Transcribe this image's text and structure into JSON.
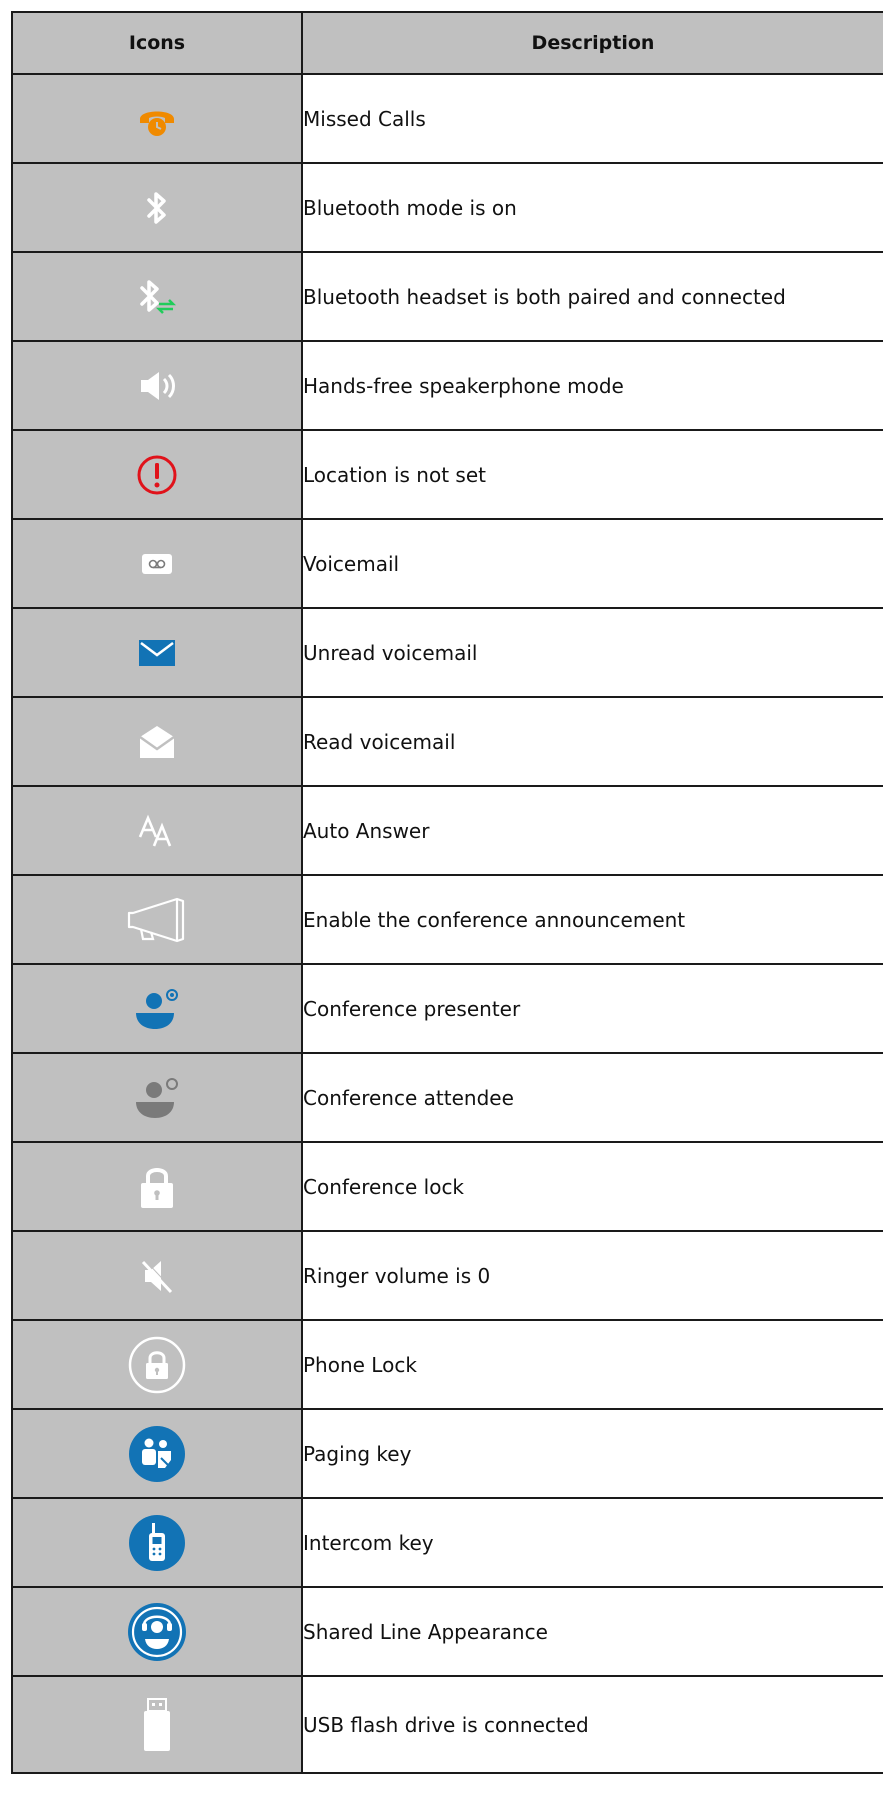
{
  "table": {
    "headers": {
      "icons": "Icons",
      "description": "Description"
    },
    "rows": [
      {
        "icon": "missed-calls-icon",
        "description": "Missed Calls"
      },
      {
        "icon": "bluetooth-icon",
        "description": "Bluetooth mode is on"
      },
      {
        "icon": "bluetooth-connected-icon",
        "description": "Bluetooth headset is both paired and connected"
      },
      {
        "icon": "speakerphone-icon",
        "description": "Hands-free speakerphone mode"
      },
      {
        "icon": "alert-icon",
        "description": "Location is not set"
      },
      {
        "icon": "voicemail-icon",
        "description": "Voicemail"
      },
      {
        "icon": "unread-voicemail-icon",
        "description": "Unread voicemail"
      },
      {
        "icon": "read-voicemail-icon",
        "description": "Read voicemail"
      },
      {
        "icon": "auto-answer-icon",
        "description": "Auto Answer"
      },
      {
        "icon": "megaphone-icon",
        "description": "Enable the conference announcement"
      },
      {
        "icon": "conference-presenter-icon",
        "description": "Conference presenter"
      },
      {
        "icon": "conference-attendee-icon",
        "description": "Conference attendee"
      },
      {
        "icon": "conference-lock-icon",
        "description": "Conference lock"
      },
      {
        "icon": "ringer-mute-icon",
        "description": "Ringer volume is 0"
      },
      {
        "icon": "phone-lock-icon",
        "description": "Phone Lock"
      },
      {
        "icon": "paging-key-icon",
        "description": "Paging key"
      },
      {
        "icon": "intercom-key-icon",
        "description": "Intercom key"
      },
      {
        "icon": "shared-line-icon",
        "description": "Shared Line Appearance"
      },
      {
        "icon": "usb-drive-icon",
        "description": "USB flash drive is connected"
      }
    ]
  },
  "colors": {
    "header_bg": "#c0c0c0",
    "icon_cell_bg": "#c0c0c0",
    "border": "#1a1a1a",
    "orange": "#f08a00",
    "red": "#e0121a",
    "blue": "#1273b5",
    "green": "#1fcc5a",
    "white": "#ffffff",
    "gray": "#7a7a7a"
  }
}
